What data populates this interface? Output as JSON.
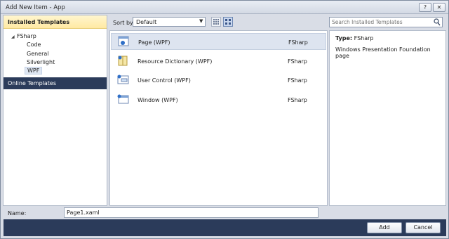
{
  "window": {
    "title": "Add New Item - App",
    "help": "?",
    "close": "✕"
  },
  "left": {
    "header": "Installed Templates",
    "tree": {
      "root": "FSharp",
      "children": [
        "Code",
        "General",
        "Silverlight",
        "WPF"
      ]
    },
    "online": "Online Templates"
  },
  "toolbar": {
    "sort_label": "Sort by:",
    "sort_value": "Default",
    "search_placeholder": "Search Installed Templates"
  },
  "templates": [
    {
      "name": "Page (WPF)",
      "lang": "FSharp",
      "icon": "wpf-page-icon"
    },
    {
      "name": "Resource Dictionary (WPF)",
      "lang": "FSharp",
      "icon": "resource-dictionary-icon"
    },
    {
      "name": "User Control (WPF)",
      "lang": "FSharp",
      "icon": "user-control-icon"
    },
    {
      "name": "Window (WPF)",
      "lang": "FSharp",
      "icon": "wpf-window-icon"
    }
  ],
  "details": {
    "type_label": "Type:",
    "type_value": "FSharp",
    "description": "Windows Presentation Foundation page"
  },
  "name_row": {
    "label": "Name:",
    "value": "Page1.xaml"
  },
  "buttons": {
    "add": "Add",
    "cancel": "Cancel"
  },
  "colors": {
    "accent_dark": "#2b3b5a",
    "header_gold": "#ffe9a3",
    "selection": "#dde4f0"
  }
}
